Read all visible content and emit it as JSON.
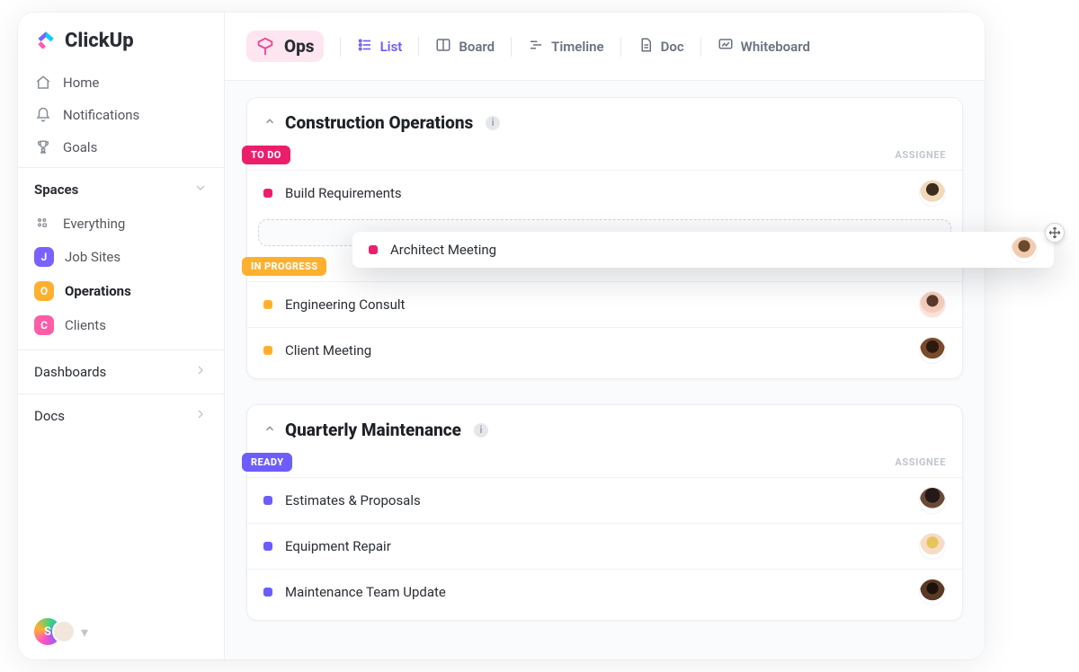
{
  "brand": {
    "name": "ClickUp"
  },
  "sidebar": {
    "nav": [
      {
        "label": "Home",
        "icon": "home-icon"
      },
      {
        "label": "Notifications",
        "icon": "bell-icon"
      },
      {
        "label": "Goals",
        "icon": "trophy-icon"
      }
    ],
    "spaces_header": "Spaces",
    "everything_label": "Everything",
    "spaces": [
      {
        "initial": "J",
        "label": "Job Sites",
        "color": "#7b61ff",
        "active": false
      },
      {
        "initial": "O",
        "label": "Operations",
        "color": "#ffb02e",
        "active": true
      },
      {
        "initial": "C",
        "label": "Clients",
        "color": "#ff5ca8",
        "active": false
      }
    ],
    "rows": [
      {
        "label": "Dashboards"
      },
      {
        "label": "Docs"
      }
    ],
    "presence_initial": "S"
  },
  "topbar": {
    "space_name": "Ops",
    "views": [
      {
        "label": "List",
        "icon": "list-icon",
        "active": true
      },
      {
        "label": "Board",
        "icon": "board-icon",
        "active": false
      },
      {
        "label": "Timeline",
        "icon": "timeline-icon",
        "active": false
      },
      {
        "label": "Doc",
        "icon": "doc-icon",
        "active": false
      },
      {
        "label": "Whiteboard",
        "icon": "whiteboard-icon",
        "active": false
      }
    ]
  },
  "lists": [
    {
      "title": "Construction Operations",
      "groups": [
        {
          "status": "TO DO",
          "status_color": "#ec1e6c",
          "assignee_header": "ASSIGNEE",
          "tasks": [
            {
              "name": "Build Requirements",
              "dot": "#ec1e6c",
              "avatar": "c1"
            }
          ],
          "show_drop_slot": true
        },
        {
          "status": "IN PROGRESS",
          "status_color": "#ffb02e",
          "tasks": [
            {
              "name": "Engineering Consult",
              "dot": "#ffb02e",
              "avatar": "c2"
            },
            {
              "name": "Client Meeting",
              "dot": "#ffb02e",
              "avatar": "c3"
            }
          ]
        }
      ]
    },
    {
      "title": "Quarterly Maintenance",
      "groups": [
        {
          "status": "READY",
          "status_color": "#6d5cff",
          "assignee_header": "ASSIGNEE",
          "tasks": [
            {
              "name": "Estimates & Proposals",
              "dot": "#6d5cff",
              "avatar": "c4"
            },
            {
              "name": "Equipment Repair",
              "dot": "#6d5cff",
              "avatar": "c5"
            },
            {
              "name": "Maintenance Team Update",
              "dot": "#6d5cff",
              "avatar": "c6"
            }
          ]
        }
      ]
    }
  ],
  "dragging_task": {
    "name": "Architect Meeting",
    "dot": "#ec1e6c",
    "avatar": "c7"
  }
}
